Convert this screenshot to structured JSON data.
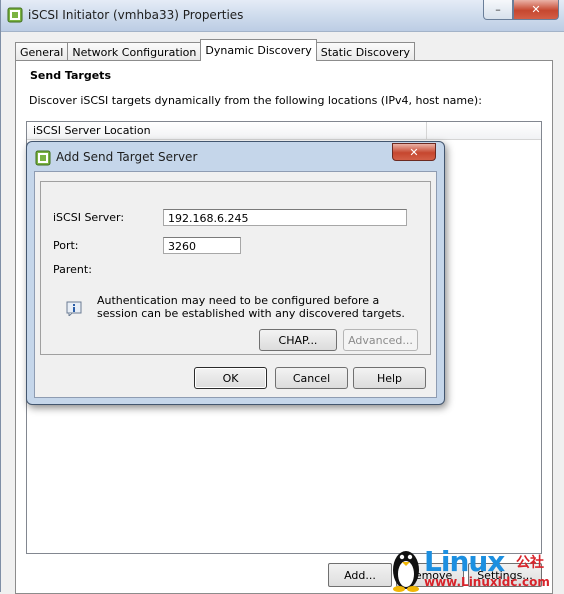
{
  "window": {
    "title": "iSCSI Initiator (vmhba33) Properties",
    "close_glyph": "✕",
    "tabs": [
      "General",
      "Network Configuration",
      "Dynamic Discovery",
      "Static Discovery"
    ],
    "active_tab": "Dynamic Discovery"
  },
  "panel": {
    "section_title": "Send Targets",
    "description": "Discover iSCSI targets dynamically from the following locations (IPv4, host name):",
    "column_header": "iSCSI Server Location",
    "buttons": {
      "add": "Add...",
      "remove": "Remove",
      "settings": "Settings..."
    }
  },
  "dialog": {
    "title": "Add Send Target Server",
    "close_glyph": "✕",
    "server_label": "iSCSI Server:",
    "server_value": "192.168.6.245",
    "port_label": "Port:",
    "port_value": "3260",
    "parent_label": "Parent:",
    "info_text": "Authentication may need to be configured before a session can be established with any discovered targets.",
    "chap_button": "CHAP...",
    "advanced_button": "Advanced...",
    "ok_button": "OK",
    "cancel_button": "Cancel",
    "help_button": "Help"
  },
  "watermark": {
    "brand": "Linux",
    "brand_cn": "公社",
    "url": "www.Linuxidc.com"
  },
  "colors": {
    "title_gradient_top": "#e5ecf6",
    "close_red": "#c6472f",
    "dialog_frame": "#c5d6ea",
    "watermark_blue": "#1c8fe0",
    "watermark_red": "#d8232a"
  }
}
